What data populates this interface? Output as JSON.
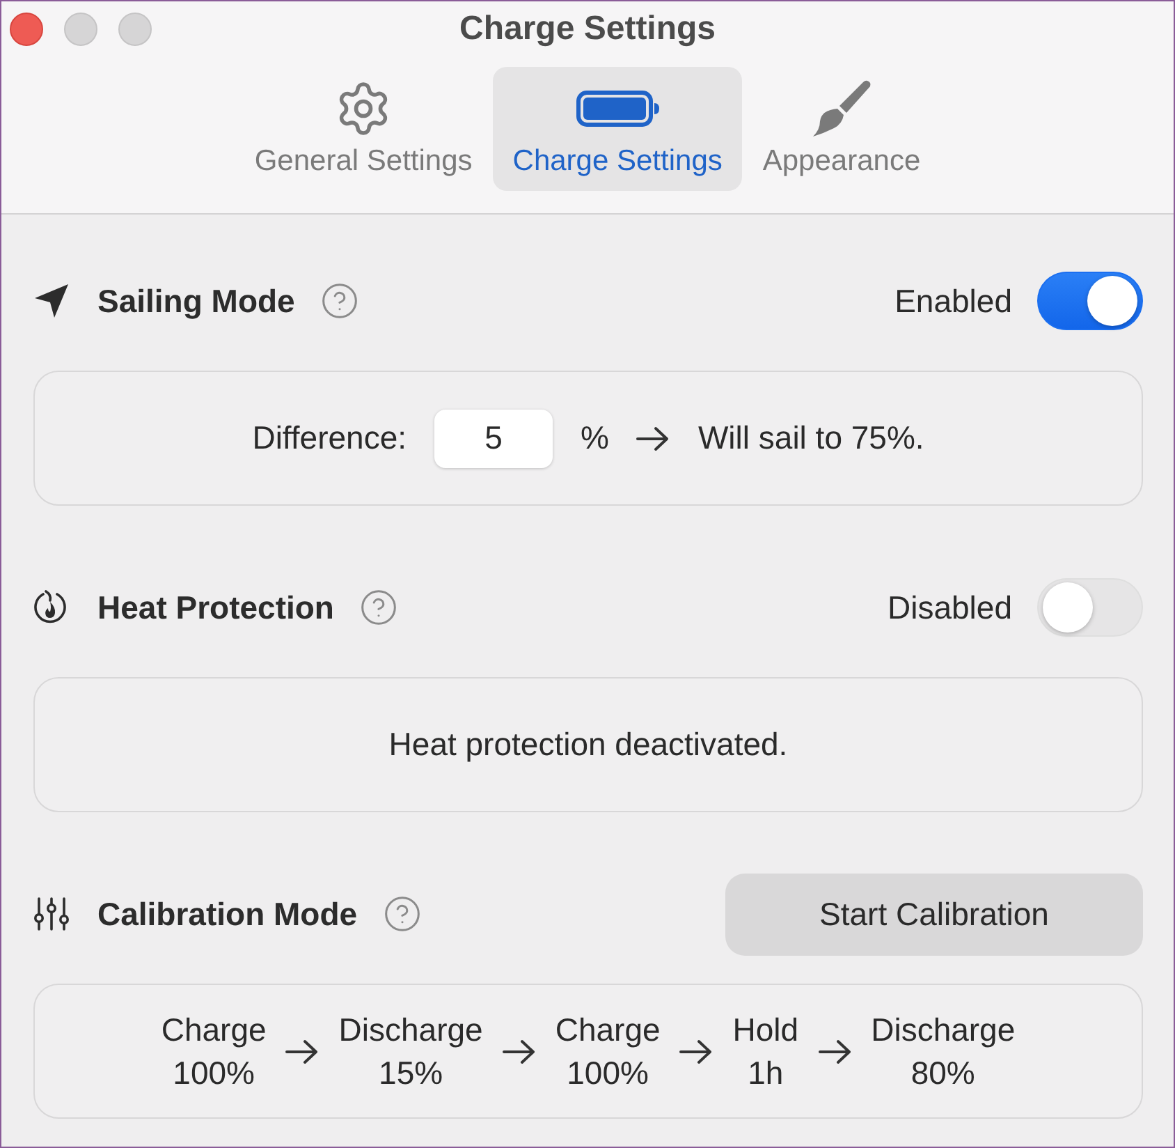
{
  "window": {
    "title": "Charge Settings"
  },
  "window_controls": [
    {
      "kind": "close",
      "disabled": false
    },
    {
      "kind": "minimize",
      "disabled": true
    },
    {
      "kind": "zoom",
      "disabled": true
    }
  ],
  "tabs": [
    {
      "label": "General Settings",
      "selected": false
    },
    {
      "label": "Charge Settings",
      "selected": true
    },
    {
      "label": "Appearance",
      "selected": false
    }
  ],
  "sailing_mode": {
    "title": "Sailing Mode",
    "status": "Enabled",
    "on": true,
    "difference": {
      "label": "Difference:",
      "value": "5",
      "unit": "%",
      "result": "Will sail to 75%."
    }
  },
  "heat_protection": {
    "title": "Heat Protection",
    "status": "Disabled",
    "on": false,
    "message": "Heat protection deactivated."
  },
  "calibration_mode": {
    "title": "Calibration Mode",
    "button": "Start Calibration",
    "steps": [
      {
        "action": "Charge",
        "target": "100%"
      },
      {
        "action": "Discharge",
        "target": "15%"
      },
      {
        "action": "Charge",
        "target": "100%"
      },
      {
        "action": "Hold",
        "target": "1h"
      },
      {
        "action": "Discharge",
        "target": "80%"
      }
    ]
  }
}
